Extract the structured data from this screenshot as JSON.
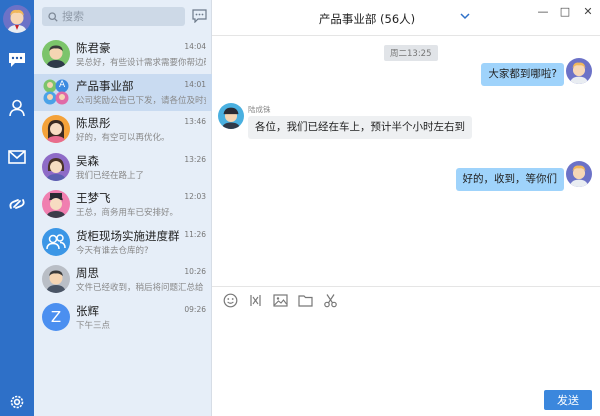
{
  "colors": {
    "rail": "#2e70c8",
    "list_bg": "#e6eef8",
    "active_row": "#c9dbf1",
    "bubble_out": "#9fd3fb",
    "bubble_in": "#eef0f2",
    "send": "#3b87dd"
  },
  "rail": {
    "icons": [
      "chat-icon",
      "contacts-icon",
      "mail-icon",
      "link-icon",
      "settings-icon"
    ]
  },
  "search": {
    "placeholder": "搜索"
  },
  "conversations": [
    {
      "name": "陈君豪",
      "time": "14:04",
      "preview": "吴总好，有些设计需求需要你帮边确"
    },
    {
      "name": "产品事业部",
      "time": "14:01",
      "preview": "公司奖励公告已下发，请各位及时查"
    },
    {
      "name": "陈思彤",
      "time": "13:46",
      "preview": "好的，有空可以再优化。"
    },
    {
      "name": "吴森",
      "time": "13:26",
      "preview": "我们已经在路上了"
    },
    {
      "name": "王梦飞",
      "time": "12:03",
      "preview": "王总，商务用车已安排好。"
    },
    {
      "name": "货柜现场实施进度群",
      "time": "11:26",
      "preview": "今天有谁去仓库的?"
    },
    {
      "name": "周思",
      "time": "10:26",
      "preview": "文件已经收到，稍后将问题汇总给"
    },
    {
      "name": "张辉",
      "time": "09:26",
      "preview": "下午三点"
    }
  ],
  "group_badge": "A",
  "avatar_letter_zhang": "Z",
  "chat": {
    "title": "产品事业部 (56人)",
    "timestamp": "周二13:25",
    "messages": [
      {
        "text": "大家都到哪啦?"
      },
      {
        "sender": "陆成铢",
        "text": "各位，我们已经在车上，预计半个小时左右到"
      },
      {
        "text": "好的，收到，等你们"
      }
    ]
  },
  "window": {
    "minimize": "—",
    "maximize": "□",
    "close": "✕"
  },
  "composer": {
    "send_label": "发送"
  }
}
